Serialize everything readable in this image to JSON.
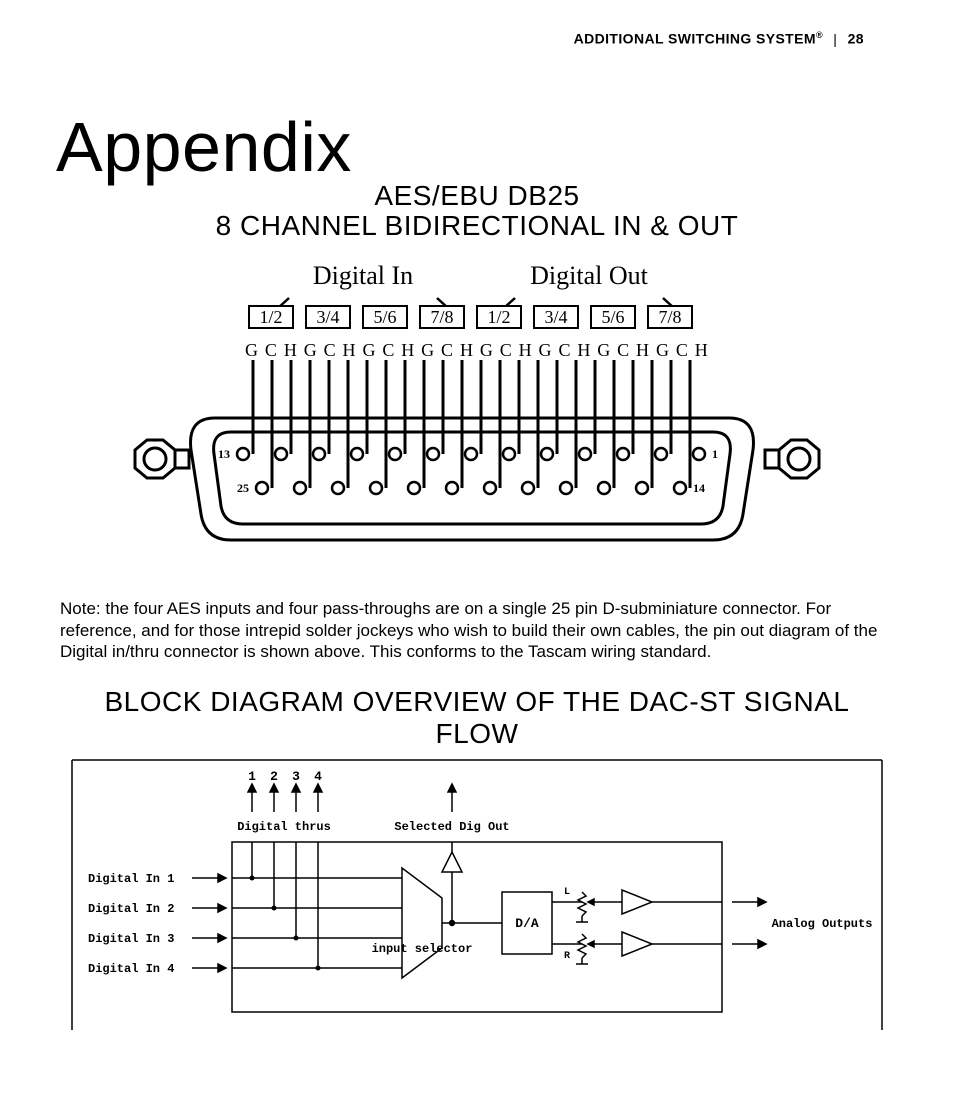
{
  "header": {
    "title": "ADDITIONAL SWITCHING SYSTEM",
    "page": "28"
  },
  "appendix": {
    "title": "Appendix",
    "sub1": "AES/EBU DB25",
    "sub2": "8 CHANNEL BIDIRECTIONAL IN & OUT"
  },
  "pinout": {
    "label_in": "Digital In",
    "label_out": "Digital Out",
    "pairs": [
      "1/2",
      "3/4",
      "5/6",
      "7/8",
      "1/2",
      "3/4",
      "5/6",
      "7/8"
    ],
    "gch": "G C H G C H G C H G C H G C H G C H G C H G C H",
    "pin13": "13",
    "pin1": "1",
    "pin25": "25",
    "pin14": "14"
  },
  "note": "Note: the four AES inputs and four pass-throughs are on a single 25 pin D-subminiature connector.  For reference, and for those intrepid solder jockeys who wish to build their own cables, the pin out diagram of the Digital in/thru connector is shown above.  This conforms to the Tascam wiring standard.",
  "block_title": "BLOCK DIAGRAM OVERVIEW OF THE DAC-ST SIGNAL FLOW",
  "block": {
    "thru_nums": [
      "1",
      "2",
      "3",
      "4"
    ],
    "thru_label": "Digital thrus",
    "sel_out": "Selected Dig Out",
    "in1": "Digital In 1",
    "in2": "Digital In 2",
    "in3": "Digital In 3",
    "in4": "Digital In 4",
    "selector": "input selector",
    "da": "D/A",
    "L": "L",
    "R": "R",
    "analog": "Analog Outputs"
  }
}
